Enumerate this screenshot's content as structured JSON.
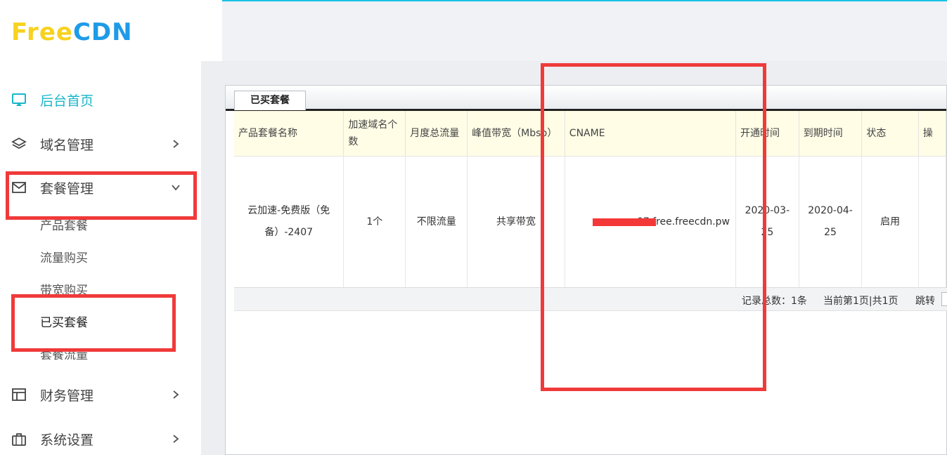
{
  "brand": {
    "logo_part1": "Free",
    "logo_part2": "CDN",
    "color_yellow": "#f7d21f",
    "color_blue": "#1e9be8"
  },
  "sidebar": {
    "items": [
      {
        "label": "后台首页",
        "icon": "monitor-icon"
      },
      {
        "label": "域名管理",
        "icon": "layers-icon"
      },
      {
        "label": "套餐管理",
        "icon": "mail-icon"
      },
      {
        "label": "财务管理",
        "icon": "table-icon"
      },
      {
        "label": "系统设置",
        "icon": "briefcase-icon"
      }
    ],
    "sub_items": [
      "产品套餐",
      "流量购买",
      "带宽购买",
      "已买套餐",
      "套餐流量"
    ]
  },
  "panel": {
    "tab_label": "已买套餐",
    "columns": [
      "产品套餐名称",
      "加速域名个数",
      "月度总流量",
      "峰值带宽（Mbsp）",
      "CNAME",
      "开通时间",
      "到期时间",
      "状态",
      "操"
    ],
    "rows": [
      [
        "云加速-免费版（免备）-2407",
        "1个",
        "不限流量",
        "共享带宽",
        "07.free.freecdn.pw",
        "2020-03-25",
        "2020-04-25",
        "启用",
        ""
      ]
    ],
    "pager": {
      "total": "记录总数：1条",
      "page_info": "当前第1页|共1页",
      "jump": "跳转"
    }
  },
  "colors": {
    "accent": "#19b6c9",
    "highlight_red": "#f03a3a",
    "header_bg": "#fffde6"
  }
}
